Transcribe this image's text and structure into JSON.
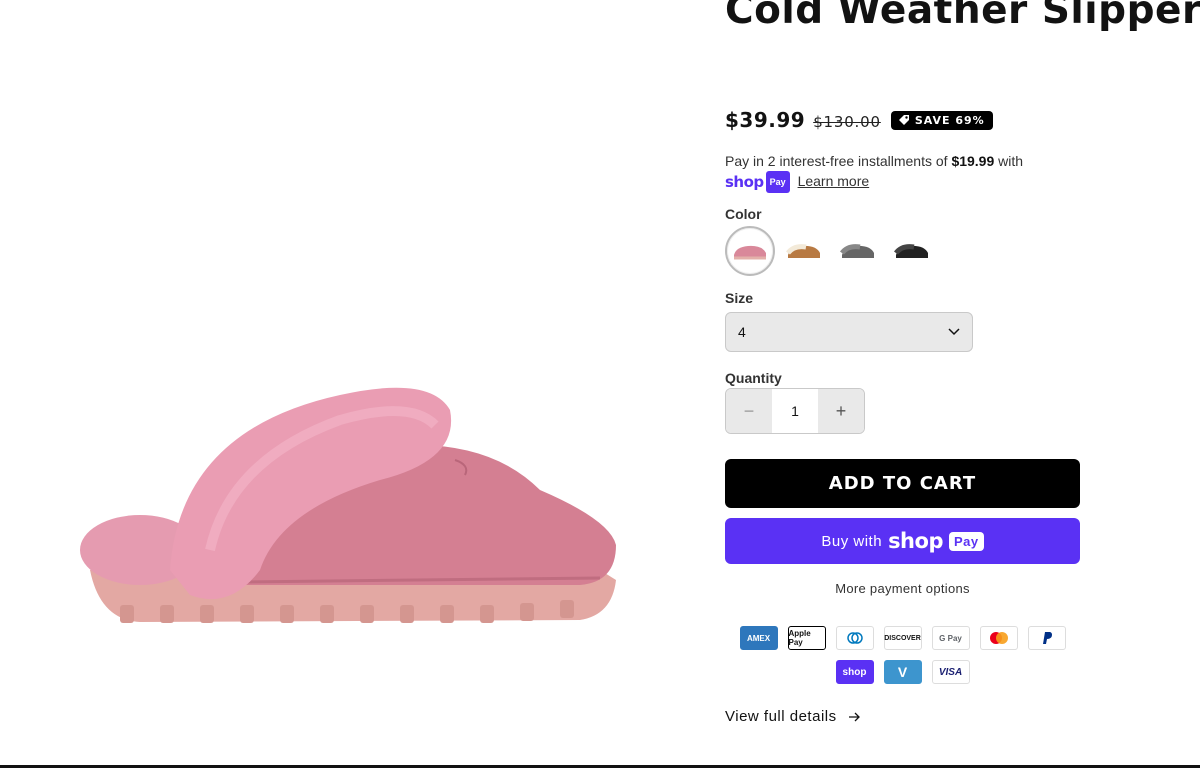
{
  "product": {
    "title": "Cold Weather Slippers",
    "price": "$39.99",
    "compare_price": "$130.00",
    "badge": "SAVE 69%",
    "installments": {
      "prefix": "Pay in 2 interest-free installments of",
      "amount": "$19.99",
      "suffix": "with",
      "shop_word": "shop",
      "shop_pill": "Pay",
      "learn_more": "Learn more"
    },
    "color": {
      "label": "Color",
      "swatches": [
        {
          "name": "pink",
          "selected": true,
          "color": "#d9889a"
        },
        {
          "name": "chestnut",
          "selected": false,
          "color": "#b87a43"
        },
        {
          "name": "grey",
          "selected": false,
          "color": "#666666"
        },
        {
          "name": "black",
          "selected": false,
          "color": "#222222"
        }
      ]
    },
    "size": {
      "label": "Size",
      "value": "4"
    },
    "quantity": {
      "label": "Quantity",
      "value": "1",
      "minus": "−",
      "plus": "+"
    },
    "add_to_cart": "ADD TO CART",
    "buy_now": {
      "prefix": "Buy with",
      "shop_word": "shop",
      "pill": "Pay"
    },
    "more_payment_options": "More payment options",
    "payment_icons": [
      "AMEX",
      "Apple Pay",
      "Diners",
      "DISCOVER",
      "G Pay",
      "Mastercard",
      "PayPal",
      "shop",
      "Venmo",
      "VISA"
    ],
    "view_full_details": "View full details"
  },
  "colors": {
    "shop_pay_purple": "#5a31f4",
    "slipper_pink": "#d9889a"
  }
}
